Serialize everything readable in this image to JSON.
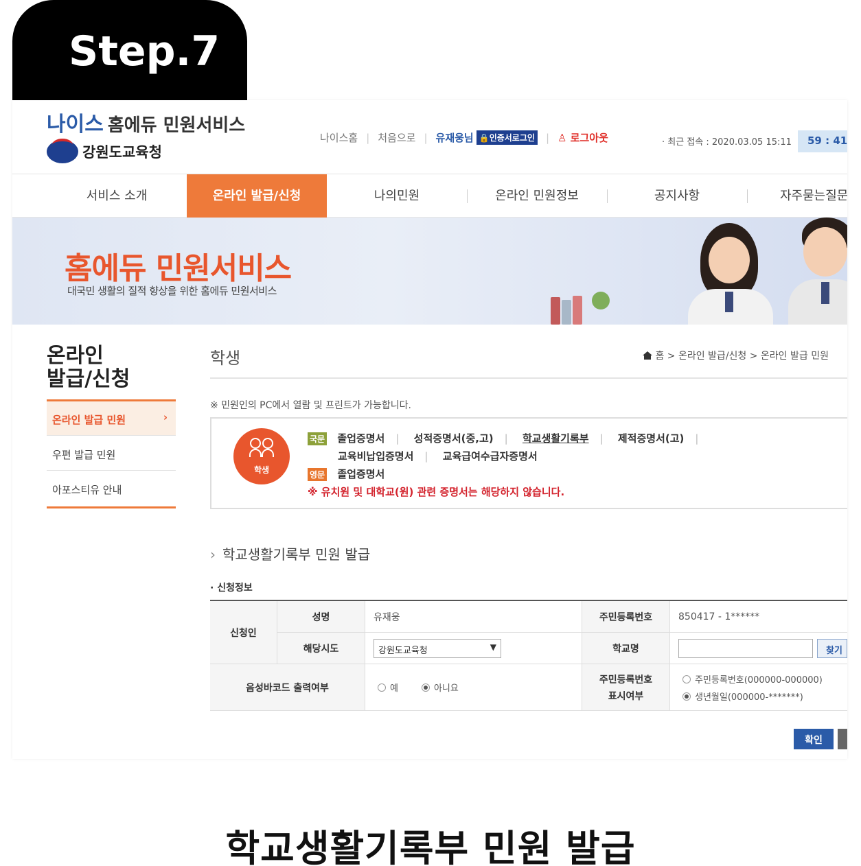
{
  "step_label": "Step.7",
  "header": {
    "logo_brand": "나이스",
    "logo_rest": "홈에듀 민원서비스",
    "office_name": "강원도교육청",
    "top_links": [
      "나이스홈",
      "처음으로"
    ],
    "user_name": "유재웅님",
    "cert_label": "인증서로그인",
    "logout_label": "로그아웃",
    "last_login": "· 최근 접속 : 2020.03.05 15:11",
    "timer": "59 : 41"
  },
  "main_nav": [
    "서비스 소개",
    "온라인 발급/신청",
    "나의민원",
    "온라인 민원정보",
    "공지사항",
    "자주묻는질문"
  ],
  "banner": {
    "title": "홈에듀 민원서비스",
    "subtitle": "대국민 생활의 질적 향상을 위한 홈에듀 민원서비스"
  },
  "sidebar": {
    "title_line1": "온라인",
    "title_line2": "발급/신청",
    "items": [
      {
        "label": "온라인 발급 민원",
        "active": true
      },
      {
        "label": "우편 발급 민원",
        "active": false
      },
      {
        "label": "아포스티유 안내",
        "active": false
      }
    ]
  },
  "content": {
    "title": "학생",
    "breadcrumb": "홈 > 온라인 발급/신청 > 온라인 발급 민원",
    "notice": "※ 민원인의 PC에서 열람 및 프린트가 가능합니다.",
    "badge_label": "학생",
    "tag_korean": "국문",
    "tag_english": "영문",
    "docs_kr_row1": [
      "졸업증명서",
      "성적증명서(중,고)",
      "학교생활기록부",
      "제적증명서(고)"
    ],
    "docs_kr_row2": [
      "교육비납입증명서",
      "교육급여수급자증명서"
    ],
    "docs_en": [
      "졸업증명서"
    ],
    "warning": "※ 유치원 및 대학교(원) 관련 증명서는 해당하지 않습니다."
  },
  "form": {
    "section_title": "학교생활기록부 민원 발급",
    "sub_title": "· 신청정보",
    "applicant_label": "신청인",
    "name_label": "성명",
    "name_value": "유재웅",
    "rrn_label": "주민등록번호",
    "rrn_value": "850417 - 1******",
    "region_label": "해당시도",
    "region_value": "강원도교육청",
    "school_label": "학교명",
    "school_value": "",
    "find_label": "찾기",
    "barcode_label": "음성바코드 출력여부",
    "barcode_yes": "예",
    "barcode_no": "아니요",
    "barcode_selected": "아니요",
    "rrn_display_label_1": "주민등록번호",
    "rrn_display_label_2": "표시여부",
    "rrn_option_full": "주민등록번호(000000-000000)",
    "rrn_option_birth": "생년월일(000000-*******)",
    "rrn_option_selected": "생년월일(000000-*******)",
    "confirm_label": "확인"
  },
  "caption": "학교생활기록부 민원 발급",
  "colors": {
    "accent_orange": "#ee7a3a",
    "brand_blue": "#2b5ba8",
    "warning_red": "#d3232d"
  }
}
